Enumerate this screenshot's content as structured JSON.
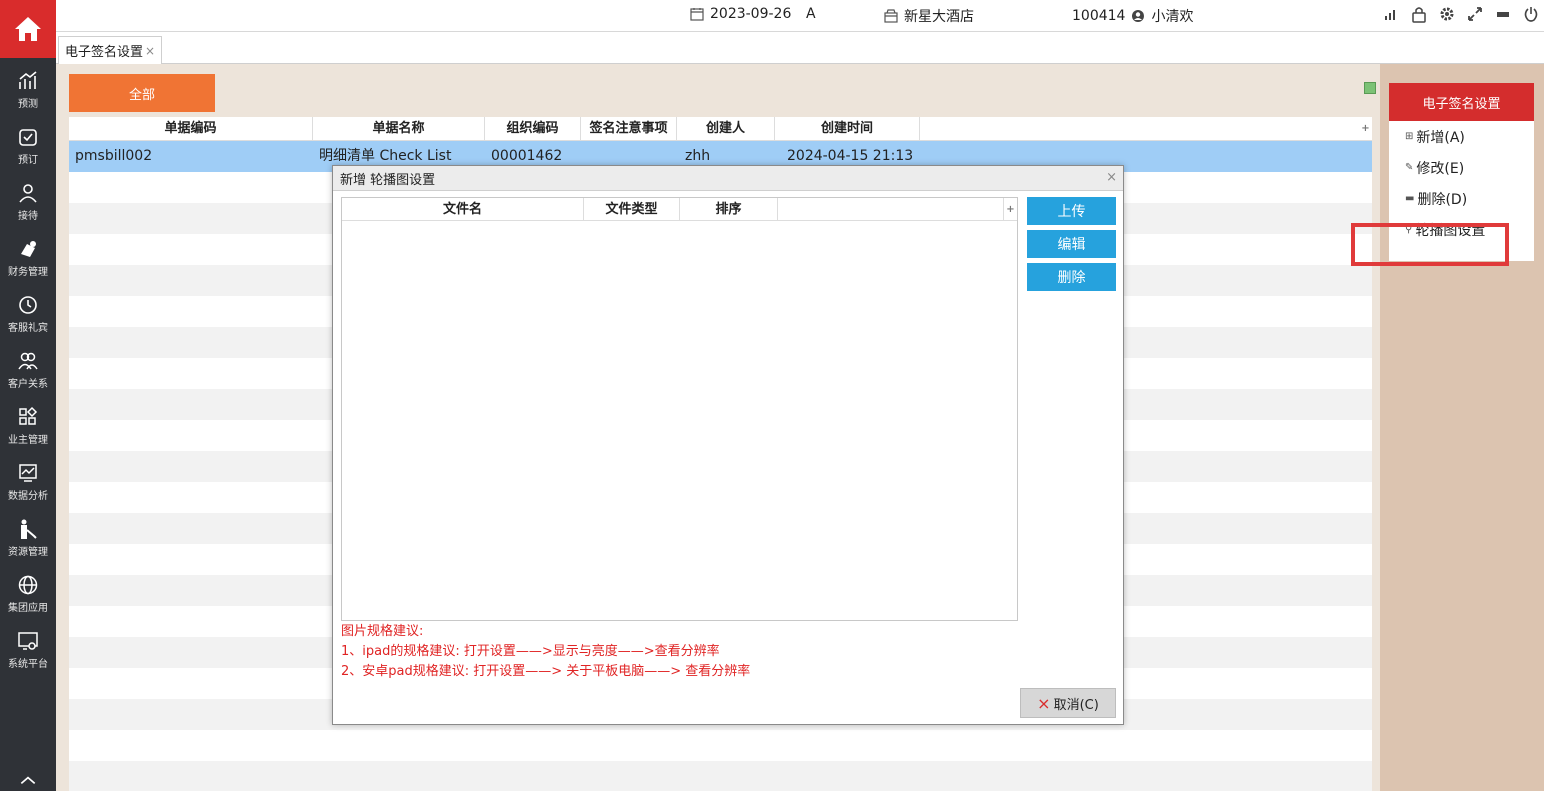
{
  "topbar": {
    "date": "2023-09-26",
    "shift": "A",
    "hotel": "新星大酒店",
    "user_id": "100414",
    "user_name": "小清欢"
  },
  "sidebar": {
    "items": [
      {
        "label": "预测",
        "icon": "forecast-icon"
      },
      {
        "label": "预订",
        "icon": "booking-icon"
      },
      {
        "label": "接待",
        "icon": "reception-icon"
      },
      {
        "label": "财务管理",
        "icon": "finance-icon"
      },
      {
        "label": "客服礼宾",
        "icon": "concierge-icon"
      },
      {
        "label": "客户关系",
        "icon": "customers-icon"
      },
      {
        "label": "业主管理",
        "icon": "owner-icon"
      },
      {
        "label": "数据分析",
        "icon": "analytics-icon"
      },
      {
        "label": "资源管理",
        "icon": "resource-icon"
      },
      {
        "label": "集团应用",
        "icon": "group-icon"
      },
      {
        "label": "系统平台",
        "icon": "system-icon"
      }
    ]
  },
  "tab": {
    "label": "电子签名设置",
    "close": "×"
  },
  "filter": {
    "all_label": "全部"
  },
  "grid": {
    "columns": [
      "单据编码",
      "单据名称",
      "组织编码",
      "签名注意事项",
      "创建人",
      "创建时间"
    ],
    "rows": [
      {
        "code": "pmsbill002",
        "name": "明细清单  Check List",
        "org": "00001462",
        "notes": "",
        "creator": "zhh",
        "created": "2024-04-15 21:13"
      }
    ]
  },
  "right_menu": {
    "title": "电子签名设置",
    "items": [
      {
        "label": "新增(A)",
        "icon": "plus-box-icon"
      },
      {
        "label": "修改(E)",
        "icon": "edit-icon"
      },
      {
        "label": "删除(D)",
        "icon": "trash-icon"
      },
      {
        "label": "轮播图设置",
        "icon": "wrench-icon"
      }
    ]
  },
  "modal": {
    "title": "新增 轮播图设置",
    "close": "×",
    "columns": [
      "文件名",
      "文件类型",
      "排序"
    ],
    "buttons": {
      "upload": "上传",
      "edit": "编辑",
      "delete": "删除"
    },
    "notes": {
      "heading": "图片规格建议:",
      "line1": "1、ipad的规格建议: 打开设置——>显示与亮度——>查看分辨率",
      "line2": "2、安卓pad规格建议: 打开设置——> 关于平板电脑——> 查看分辨率"
    },
    "cancel_label": "取消(C)",
    "cancel_icon": "×"
  },
  "colors": {
    "sidebar_bg": "#2f3237",
    "home_red": "#d92c2c",
    "all_button": "#f07434",
    "row_selected": "#9fcdf6",
    "modal_button": "#26a2dd",
    "menu_header": "#d42d2d",
    "highlight": "#e03a3a",
    "notes_red": "#e02424"
  }
}
